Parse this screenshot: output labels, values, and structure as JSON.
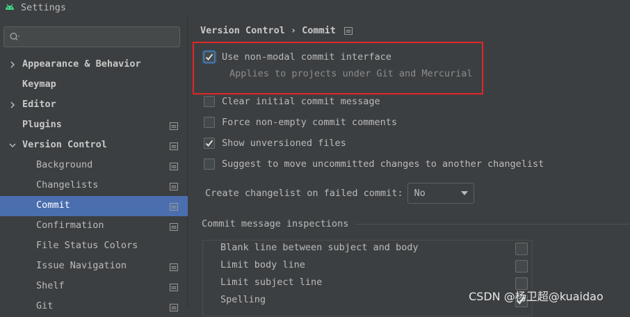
{
  "window": {
    "title": "Settings"
  },
  "sidebar": {
    "search": {
      "placeholder": ""
    },
    "items": [
      {
        "label": "Appearance & Behavior",
        "level": 1,
        "arrow": "right",
        "project_icon": false,
        "selected": false
      },
      {
        "label": "Keymap",
        "level": 1,
        "arrow": "none",
        "project_icon": false,
        "selected": false
      },
      {
        "label": "Editor",
        "level": 1,
        "arrow": "right",
        "project_icon": false,
        "selected": false
      },
      {
        "label": "Plugins",
        "level": 1,
        "arrow": "none",
        "project_icon": true,
        "selected": false
      },
      {
        "label": "Version Control",
        "level": 1,
        "arrow": "down",
        "project_icon": true,
        "selected": false
      },
      {
        "label": "Background",
        "level": 2,
        "arrow": "none",
        "project_icon": true,
        "selected": false
      },
      {
        "label": "Changelists",
        "level": 2,
        "arrow": "none",
        "project_icon": true,
        "selected": false
      },
      {
        "label": "Commit",
        "level": 2,
        "arrow": "none",
        "project_icon": true,
        "selected": true
      },
      {
        "label": "Confirmation",
        "level": 2,
        "arrow": "none",
        "project_icon": true,
        "selected": false
      },
      {
        "label": "File Status Colors",
        "level": 2,
        "arrow": "none",
        "project_icon": false,
        "selected": false
      },
      {
        "label": "Issue Navigation",
        "level": 2,
        "arrow": "none",
        "project_icon": true,
        "selected": false
      },
      {
        "label": "Shelf",
        "level": 2,
        "arrow": "none",
        "project_icon": true,
        "selected": false
      },
      {
        "label": "Git",
        "level": 2,
        "arrow": "none",
        "project_icon": true,
        "selected": false
      }
    ]
  },
  "breadcrumb": {
    "parent": "Version Control",
    "separator": "›",
    "current": "Commit"
  },
  "options": {
    "non_modal": {
      "label": "Use non-modal commit interface",
      "checked": true
    },
    "non_modal_hint": "Applies to projects under Git and Mercurial",
    "items": [
      {
        "label": "Clear initial commit message",
        "checked": false
      },
      {
        "label": "Force non-empty commit comments",
        "checked": false
      },
      {
        "label": "Show unversioned files",
        "checked": true
      },
      {
        "label": "Suggest to move uncommitted changes to another changelist",
        "checked": false
      }
    ]
  },
  "failed_commit": {
    "label": "Create changelist on failed commit:",
    "value": "No"
  },
  "inspections": {
    "title": "Commit message inspections",
    "rows": [
      {
        "label": "Blank line between subject and body",
        "checked": false
      },
      {
        "label": "Limit body line",
        "checked": false
      },
      {
        "label": "Limit subject line",
        "checked": false
      },
      {
        "label": "Spelling",
        "checked": true
      }
    ]
  },
  "watermark": "CSDN @杨卫超@kuaidao",
  "colors": {
    "background": "#3c3f41",
    "selection": "#4b6eaf",
    "highlight_box": "#e0262a",
    "android_green": "#3ddc84"
  }
}
